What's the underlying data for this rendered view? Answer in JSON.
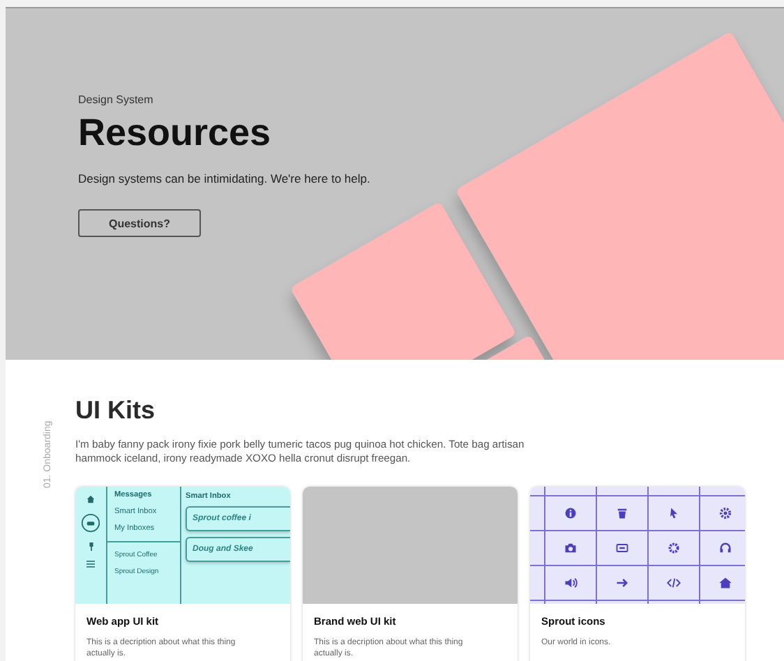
{
  "hero": {
    "eyebrow": "Design System",
    "title": "Resources",
    "subtitle": "Design systems can be intimidating. We're here to help.",
    "button": "Questions?"
  },
  "section": {
    "side_label": "01. Onboarding",
    "title": "UI Kits",
    "description": "I'm baby fanny pack irony fixie pork belly tumeric tacos pug quinoa hot chicken. Tote bag artisan hammock iceland, irony readymade XOXO hella cronut disrupt freegan."
  },
  "cards": [
    {
      "kind": "app-mock",
      "title": "Web app UI kit",
      "description": "This is a decription about what this thing actually is.",
      "mock": {
        "col1_header": "Messages",
        "col1_items": [
          "Smart Inbox",
          "My Inboxes"
        ],
        "col1_groups": [
          "Sprout Coffee",
          "Sprout Design"
        ],
        "col2_header": "Smart Inbox",
        "pills": [
          "Sprout coffee i",
          "Doug and Skee"
        ]
      }
    },
    {
      "kind": "blank",
      "title": "Brand web UI kit",
      "description": "This is a decription about what this thing actually is."
    },
    {
      "kind": "icon-grid",
      "title": "Sprout icons",
      "description": "Our world in icons."
    }
  ]
}
